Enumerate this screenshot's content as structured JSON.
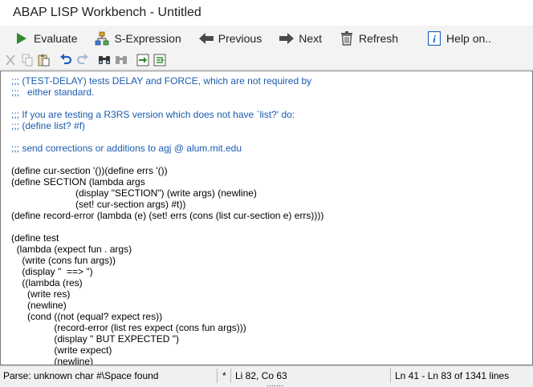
{
  "window": {
    "title": "ABAP LISP Workbench - Untitled"
  },
  "toolbar": {
    "evaluate": "Evaluate",
    "s_expression": "S-Expression",
    "previous": "Previous",
    "next": "Next",
    "refresh": "Refresh",
    "help": "Help on.."
  },
  "colors": {
    "comment": "#1a5cb0",
    "accent_green": "#2e8b2e",
    "accent_blue": "#1d5fbf"
  },
  "editor": {
    "lines": [
      {
        "text": ";;; (TEST-DELAY) tests DELAY and FORCE, which are not required by",
        "comment": true
      },
      {
        "text": ";;;   either standard.",
        "comment": true
      },
      {
        "text": "",
        "comment": false
      },
      {
        "text": ";;; If you are testing a R3RS version which does not have `list?' do:",
        "comment": true
      },
      {
        "text": ";;; (define list? #f)",
        "comment": true
      },
      {
        "text": "",
        "comment": false
      },
      {
        "text": ";;; send corrections or additions to agj @ alum.mit.edu",
        "comment": true
      },
      {
        "text": "",
        "comment": false
      },
      {
        "text": "(define cur-section '())(define errs '())",
        "comment": false
      },
      {
        "text": "(define SECTION (lambda args",
        "comment": false
      },
      {
        "text": "                        (display \"SECTION\") (write args) (newline)",
        "comment": false
      },
      {
        "text": "                        (set! cur-section args) #t))",
        "comment": false
      },
      {
        "text": "(define record-error (lambda (e) (set! errs (cons (list cur-section e) errs))))",
        "comment": false
      },
      {
        "text": "",
        "comment": false
      },
      {
        "text": "(define test",
        "comment": false
      },
      {
        "text": "  (lambda (expect fun . args)",
        "comment": false
      },
      {
        "text": "    (write (cons fun args))",
        "comment": false
      },
      {
        "text": "    (display \"  ==> \")",
        "comment": false
      },
      {
        "text": "    ((lambda (res)",
        "comment": false
      },
      {
        "text": "      (write res)",
        "comment": false
      },
      {
        "text": "      (newline)",
        "comment": false
      },
      {
        "text": "      (cond ((not (equal? expect res))",
        "comment": false
      },
      {
        "text": "                (record-error (list res expect (cons fun args)))",
        "comment": false
      },
      {
        "text": "                (display \" BUT EXPECTED \")",
        "comment": false
      },
      {
        "text": "                (write expect)",
        "comment": false
      },
      {
        "text": "                (newline)",
        "comment": false
      }
    ]
  },
  "status": {
    "message": "Parse: unknown char #\\Space found",
    "modified": "*",
    "position": "Li 82, Co 63",
    "range": "Ln 41 - Ln 83 of 1341 lines"
  }
}
